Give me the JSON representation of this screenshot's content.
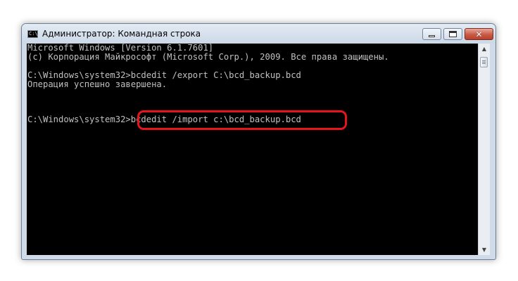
{
  "window": {
    "title": "Администратор: Командная строка",
    "icon_label": "C:\\"
  },
  "console": {
    "lines": [
      "Microsoft Windows [Version 6.1.7601]",
      "(c) Корпорация Майкрософт (Microsoft Corp.), 2009. Все права защищены.",
      "",
      "C:\\Windows\\system32>bcdedit /export C:\\bcd_backup.bcd",
      "Операция успешно завершена.",
      "",
      "C:\\Windows\\system32>bcdedit /import c:\\bcd_backup.bcd"
    ]
  },
  "icons": {
    "app": "cmd-icon",
    "minimize": "minimize-icon",
    "maximize": "maximize-icon",
    "close": "close-icon",
    "scroll_up": "scroll-up-arrow-icon",
    "scroll_down": "scroll-down-arrow-icon"
  },
  "colors": {
    "console_bg": "#000000",
    "console_text": "#c0c0c0",
    "highlight": "#e8141d"
  }
}
